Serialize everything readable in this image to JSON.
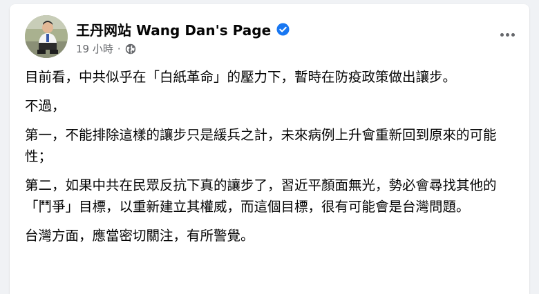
{
  "post": {
    "author": "王丹网站 Wang Dan's Page",
    "timestamp": "19 小時",
    "separator": "·",
    "paragraphs": [
      "目前看，中共似乎在「白紙革命」的壓力下，暫時在防疫政策做出讓步。",
      "不過，",
      "第一，不能排除這樣的讓步只是緩兵之計，未來病例上升會重新回到原來的可能性；",
      "第二，如果中共在民眾反抗下真的讓步了，習近平顏面無光，勢必會尋找其他的「鬥爭」目標，以重新建立其權威，而這個目標，很有可能會是台灣問題。",
      "台灣方面，應當密切關注，有所警覺。"
    ]
  },
  "icons": {
    "verified": "verified-badge-icon",
    "audience": "globe-icon",
    "more": "more-options-icon"
  },
  "colors": {
    "verified": "#1877f2",
    "text": "#050505",
    "secondary": "#65676b",
    "background": "#f0f2f5"
  }
}
